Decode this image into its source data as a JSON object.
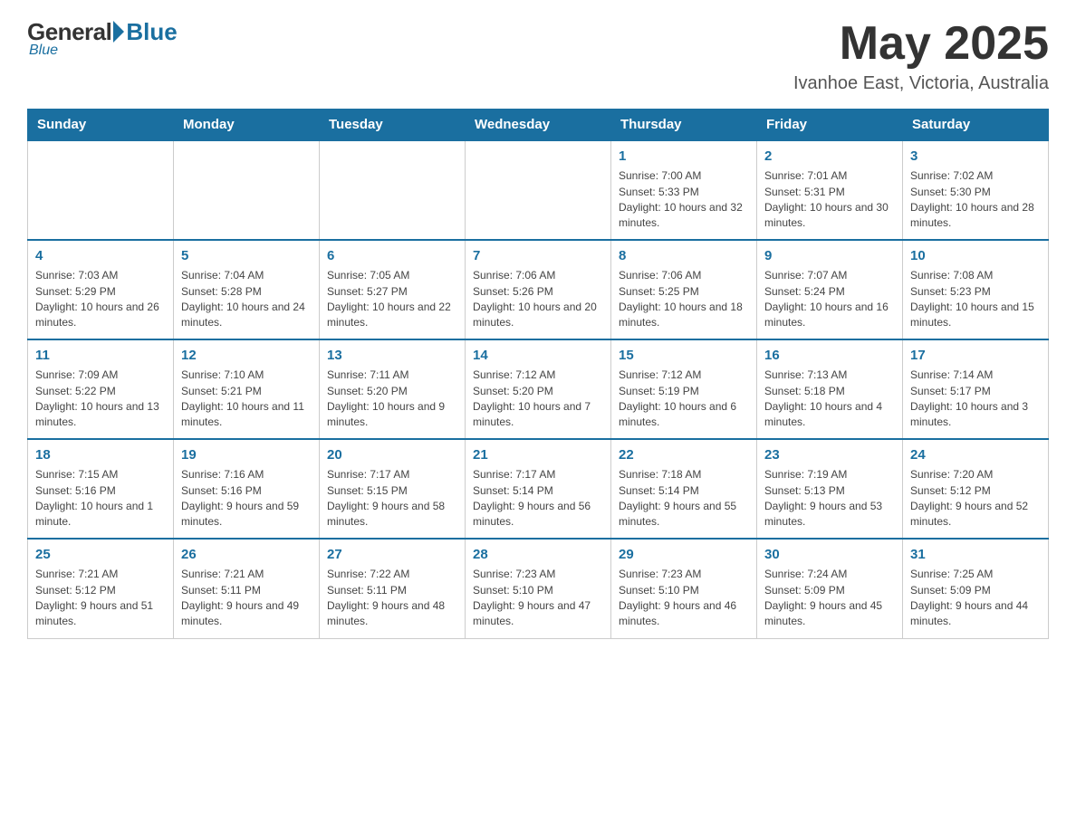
{
  "header": {
    "logo_general": "General",
    "logo_blue": "Blue",
    "month_year": "May 2025",
    "location": "Ivanhoe East, Victoria, Australia"
  },
  "days_of_week": [
    "Sunday",
    "Monday",
    "Tuesday",
    "Wednesday",
    "Thursday",
    "Friday",
    "Saturday"
  ],
  "weeks": [
    [
      {
        "day": "",
        "info": ""
      },
      {
        "day": "",
        "info": ""
      },
      {
        "day": "",
        "info": ""
      },
      {
        "day": "",
        "info": ""
      },
      {
        "day": "1",
        "info": "Sunrise: 7:00 AM\nSunset: 5:33 PM\nDaylight: 10 hours and 32 minutes."
      },
      {
        "day": "2",
        "info": "Sunrise: 7:01 AM\nSunset: 5:31 PM\nDaylight: 10 hours and 30 minutes."
      },
      {
        "day": "3",
        "info": "Sunrise: 7:02 AM\nSunset: 5:30 PM\nDaylight: 10 hours and 28 minutes."
      }
    ],
    [
      {
        "day": "4",
        "info": "Sunrise: 7:03 AM\nSunset: 5:29 PM\nDaylight: 10 hours and 26 minutes."
      },
      {
        "day": "5",
        "info": "Sunrise: 7:04 AM\nSunset: 5:28 PM\nDaylight: 10 hours and 24 minutes."
      },
      {
        "day": "6",
        "info": "Sunrise: 7:05 AM\nSunset: 5:27 PM\nDaylight: 10 hours and 22 minutes."
      },
      {
        "day": "7",
        "info": "Sunrise: 7:06 AM\nSunset: 5:26 PM\nDaylight: 10 hours and 20 minutes."
      },
      {
        "day": "8",
        "info": "Sunrise: 7:06 AM\nSunset: 5:25 PM\nDaylight: 10 hours and 18 minutes."
      },
      {
        "day": "9",
        "info": "Sunrise: 7:07 AM\nSunset: 5:24 PM\nDaylight: 10 hours and 16 minutes."
      },
      {
        "day": "10",
        "info": "Sunrise: 7:08 AM\nSunset: 5:23 PM\nDaylight: 10 hours and 15 minutes."
      }
    ],
    [
      {
        "day": "11",
        "info": "Sunrise: 7:09 AM\nSunset: 5:22 PM\nDaylight: 10 hours and 13 minutes."
      },
      {
        "day": "12",
        "info": "Sunrise: 7:10 AM\nSunset: 5:21 PM\nDaylight: 10 hours and 11 minutes."
      },
      {
        "day": "13",
        "info": "Sunrise: 7:11 AM\nSunset: 5:20 PM\nDaylight: 10 hours and 9 minutes."
      },
      {
        "day": "14",
        "info": "Sunrise: 7:12 AM\nSunset: 5:20 PM\nDaylight: 10 hours and 7 minutes."
      },
      {
        "day": "15",
        "info": "Sunrise: 7:12 AM\nSunset: 5:19 PM\nDaylight: 10 hours and 6 minutes."
      },
      {
        "day": "16",
        "info": "Sunrise: 7:13 AM\nSunset: 5:18 PM\nDaylight: 10 hours and 4 minutes."
      },
      {
        "day": "17",
        "info": "Sunrise: 7:14 AM\nSunset: 5:17 PM\nDaylight: 10 hours and 3 minutes."
      }
    ],
    [
      {
        "day": "18",
        "info": "Sunrise: 7:15 AM\nSunset: 5:16 PM\nDaylight: 10 hours and 1 minute."
      },
      {
        "day": "19",
        "info": "Sunrise: 7:16 AM\nSunset: 5:16 PM\nDaylight: 9 hours and 59 minutes."
      },
      {
        "day": "20",
        "info": "Sunrise: 7:17 AM\nSunset: 5:15 PM\nDaylight: 9 hours and 58 minutes."
      },
      {
        "day": "21",
        "info": "Sunrise: 7:17 AM\nSunset: 5:14 PM\nDaylight: 9 hours and 56 minutes."
      },
      {
        "day": "22",
        "info": "Sunrise: 7:18 AM\nSunset: 5:14 PM\nDaylight: 9 hours and 55 minutes."
      },
      {
        "day": "23",
        "info": "Sunrise: 7:19 AM\nSunset: 5:13 PM\nDaylight: 9 hours and 53 minutes."
      },
      {
        "day": "24",
        "info": "Sunrise: 7:20 AM\nSunset: 5:12 PM\nDaylight: 9 hours and 52 minutes."
      }
    ],
    [
      {
        "day": "25",
        "info": "Sunrise: 7:21 AM\nSunset: 5:12 PM\nDaylight: 9 hours and 51 minutes."
      },
      {
        "day": "26",
        "info": "Sunrise: 7:21 AM\nSunset: 5:11 PM\nDaylight: 9 hours and 49 minutes."
      },
      {
        "day": "27",
        "info": "Sunrise: 7:22 AM\nSunset: 5:11 PM\nDaylight: 9 hours and 48 minutes."
      },
      {
        "day": "28",
        "info": "Sunrise: 7:23 AM\nSunset: 5:10 PM\nDaylight: 9 hours and 47 minutes."
      },
      {
        "day": "29",
        "info": "Sunrise: 7:23 AM\nSunset: 5:10 PM\nDaylight: 9 hours and 46 minutes."
      },
      {
        "day": "30",
        "info": "Sunrise: 7:24 AM\nSunset: 5:09 PM\nDaylight: 9 hours and 45 minutes."
      },
      {
        "day": "31",
        "info": "Sunrise: 7:25 AM\nSunset: 5:09 PM\nDaylight: 9 hours and 44 minutes."
      }
    ]
  ]
}
